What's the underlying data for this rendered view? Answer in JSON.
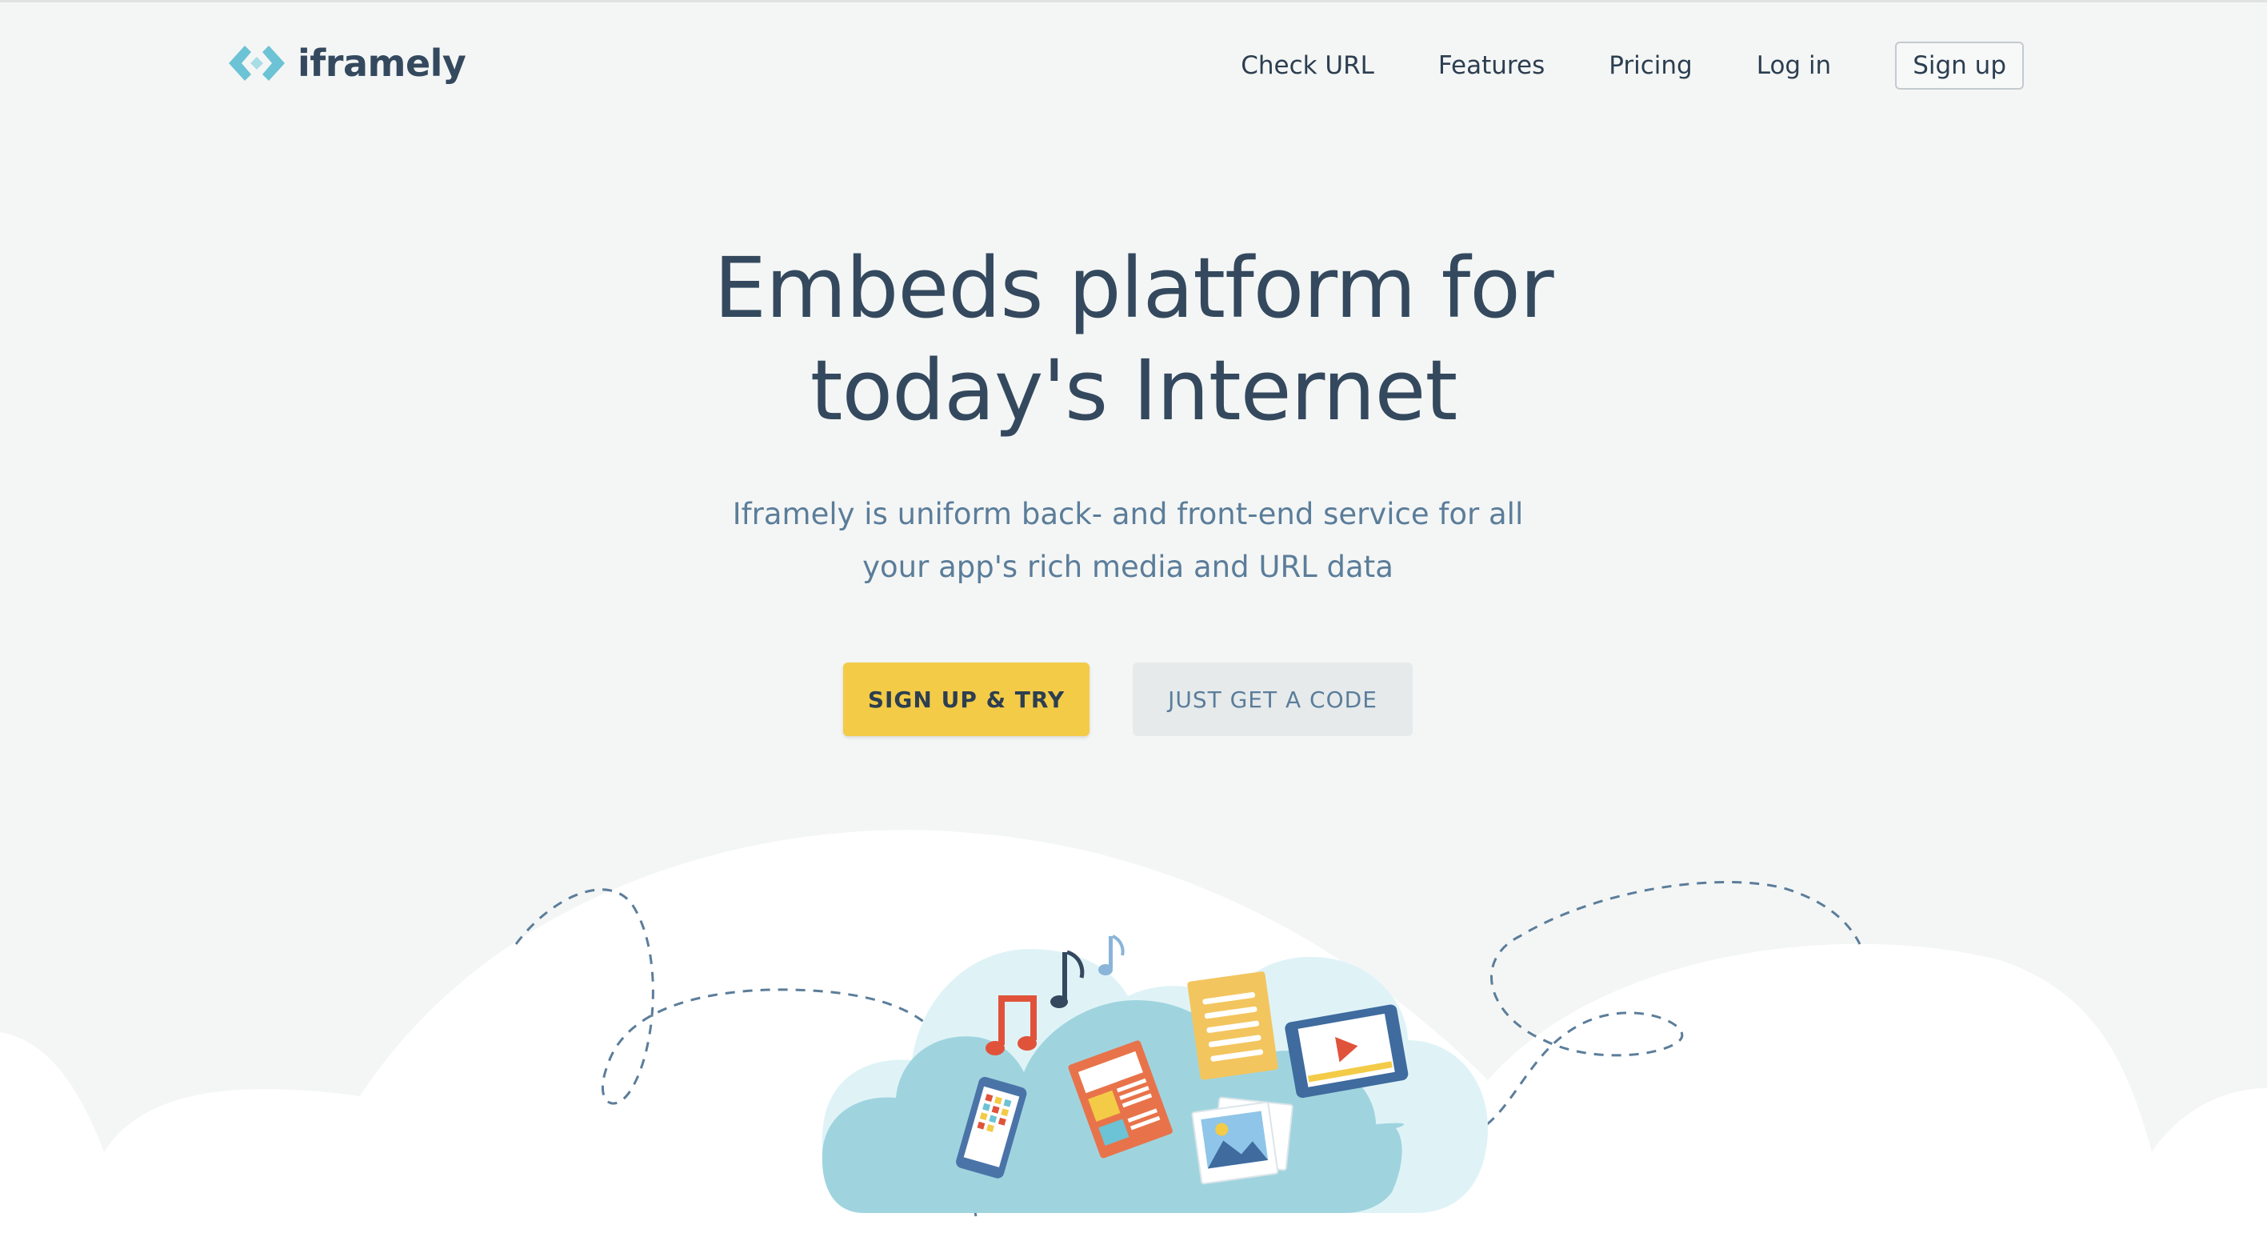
{
  "brand": {
    "name": "iframely",
    "logo_icon": "iframely-logo-icon",
    "accent_color": "#6cc3d5"
  },
  "nav": {
    "items": [
      {
        "label": "Check URL"
      },
      {
        "label": "Features"
      },
      {
        "label": "Pricing"
      },
      {
        "label": "Log in"
      }
    ],
    "signup_label": "Sign up"
  },
  "hero": {
    "title_line1": "Embeds platform for",
    "title_line2": "today's Internet",
    "subtitle_line1": "Iframely is uniform back- and front-end service for all",
    "subtitle_line2": "your app's rich media and URL data"
  },
  "cta": {
    "primary_label": "SIGN UP & TRY",
    "secondary_label": "JUST GET A CODE",
    "primary_color": "#f3cb47"
  },
  "illustration": {
    "icons": [
      "music-note-icon",
      "music-note-icon",
      "tablet-phone-icon",
      "newspaper-icon",
      "document-icon",
      "photo-icon",
      "video-player-icon"
    ]
  }
}
